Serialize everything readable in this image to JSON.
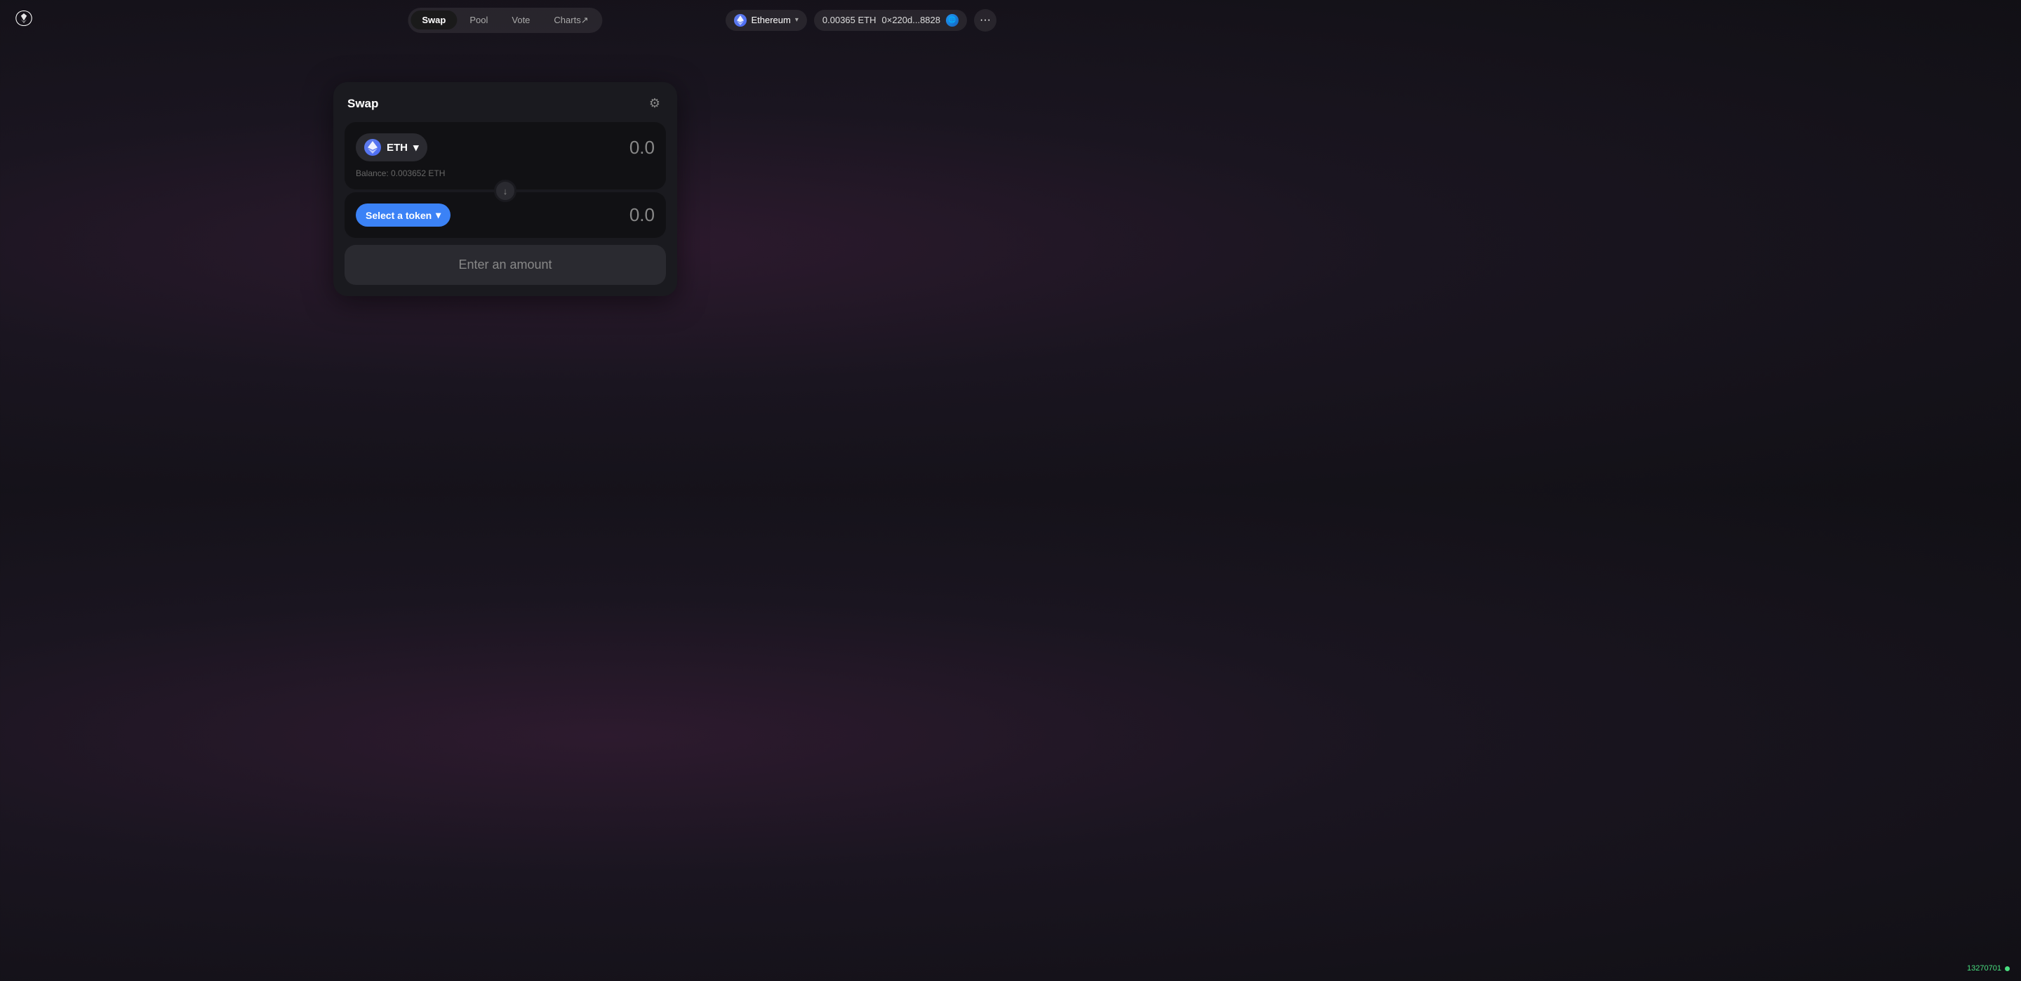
{
  "navbar": {
    "tabs": [
      {
        "id": "swap",
        "label": "Swap",
        "active": true
      },
      {
        "id": "pool",
        "label": "Pool",
        "active": false
      },
      {
        "id": "vote",
        "label": "Vote",
        "active": false
      },
      {
        "id": "charts",
        "label": "Charts↗",
        "active": false
      }
    ],
    "network": {
      "label": "Ethereum",
      "chevron": "▾"
    },
    "wallet": {
      "eth_balance": "0.00365 ETH",
      "address": "0×220d...8828"
    },
    "more_label": "···"
  },
  "swap_card": {
    "title": "Swap",
    "settings_icon": "⚙",
    "from_token": {
      "symbol": "ETH",
      "chevron": "▾",
      "amount": "0.0",
      "balance_label": "Balance: 0.003652 ETH"
    },
    "swap_arrow": "↓",
    "to_token": {
      "select_label": "Select a token",
      "chevron": "▾",
      "amount": "0.0"
    },
    "action_button": "Enter an amount"
  },
  "block": {
    "number": "13270701"
  }
}
